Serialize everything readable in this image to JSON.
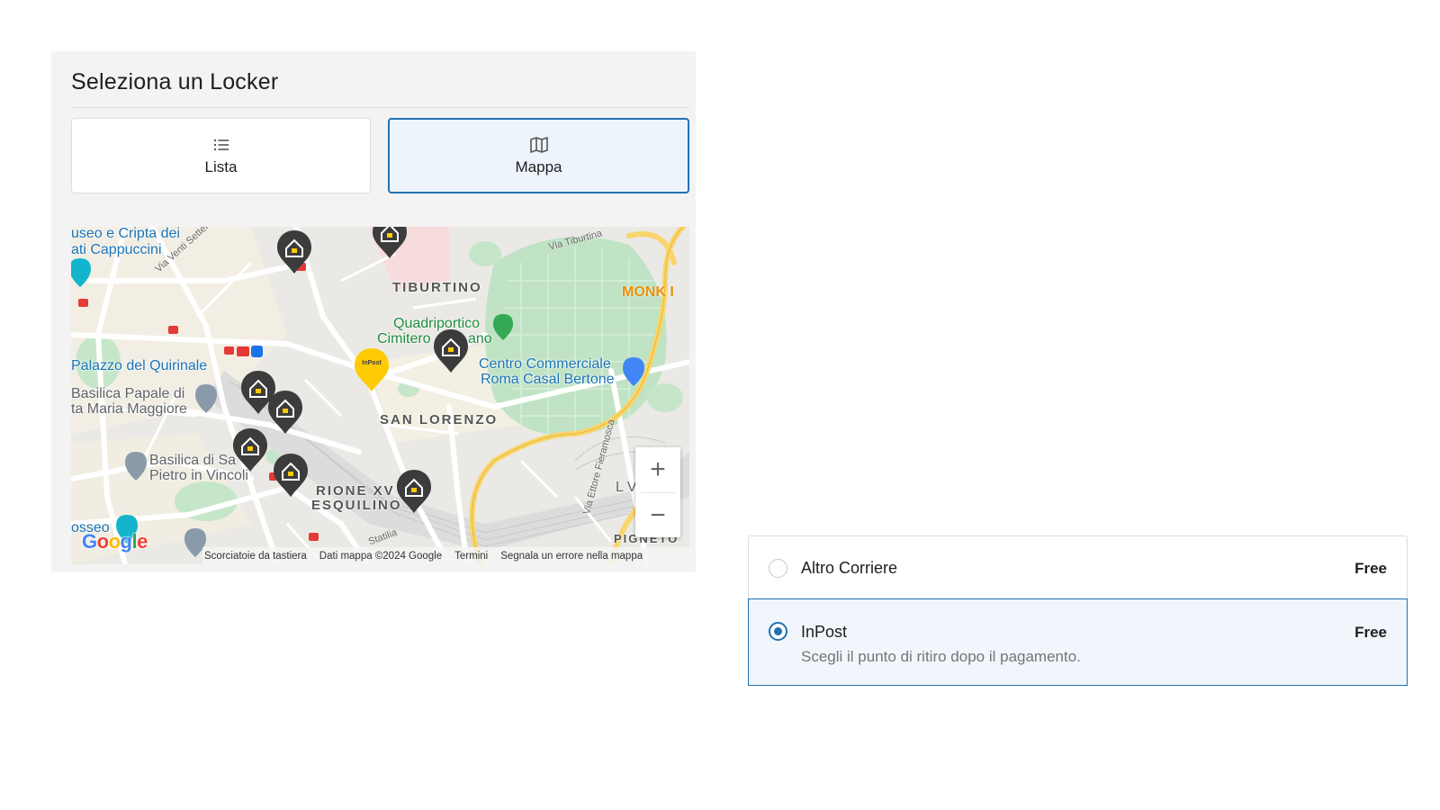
{
  "locker": {
    "title": "Seleziona un Locker",
    "tabs": [
      {
        "label": "Lista",
        "icon": "list-icon",
        "active": false
      },
      {
        "label": "Mappa",
        "icon": "map-icon",
        "active": true
      }
    ]
  },
  "map": {
    "labels": {
      "museo": "useo e Cripta dei",
      "cappuccini": "ati Cappuccini",
      "via_venti": "Via Venti Settembre",
      "tiburtino": "TIBURTINO",
      "via_tiburtina": "Via Tiburtina",
      "monk": "MONK I",
      "quadriportico_1": "Quadriportico",
      "quadriportico_2": "Cimitero",
      "quadriportico_3": "ano",
      "centro_1": "Centro Commerciale",
      "centro_2": "Roma Casal Bertone",
      "quirinale": "Palazzo del Quirinale",
      "basilica_1": "Basilica Papale di",
      "basilica_2": "ta Maria Maggiore",
      "san_lorenzo": "SAN LORENZO",
      "vincoli_1": "Basilica di Sa",
      "vincoli_2": "Pietro in Vincoli",
      "rione_1": "RIONE XV",
      "rione_2": "ESQUILINO",
      "via_ettore": "Via Ettore Fieramosca",
      "osseo": "osseo",
      "statilia": "Statilia",
      "pigneto": "PIGNETO",
      "lve": "L Ve"
    },
    "inpost_marker_text": "InPost",
    "google_logo": "Google",
    "attribution": [
      "Scorciatoie da tastiera",
      "Dati mappa ©2024 Google",
      "Termini",
      "Segnala un errore nella mappa"
    ],
    "zoom_in": "+",
    "zoom_out": "−"
  },
  "shipping": {
    "options": [
      {
        "name": "Altro Corriere",
        "price": "Free",
        "selected": false
      },
      {
        "name": "InPost",
        "price": "Free",
        "selected": true,
        "description": "Scegli il punto di ritiro dopo il pagamento."
      }
    ]
  },
  "colors": {
    "accent": "#2271b1",
    "inpost_yellow": "#ffcb05",
    "marker_dark": "#3c3c3c"
  }
}
